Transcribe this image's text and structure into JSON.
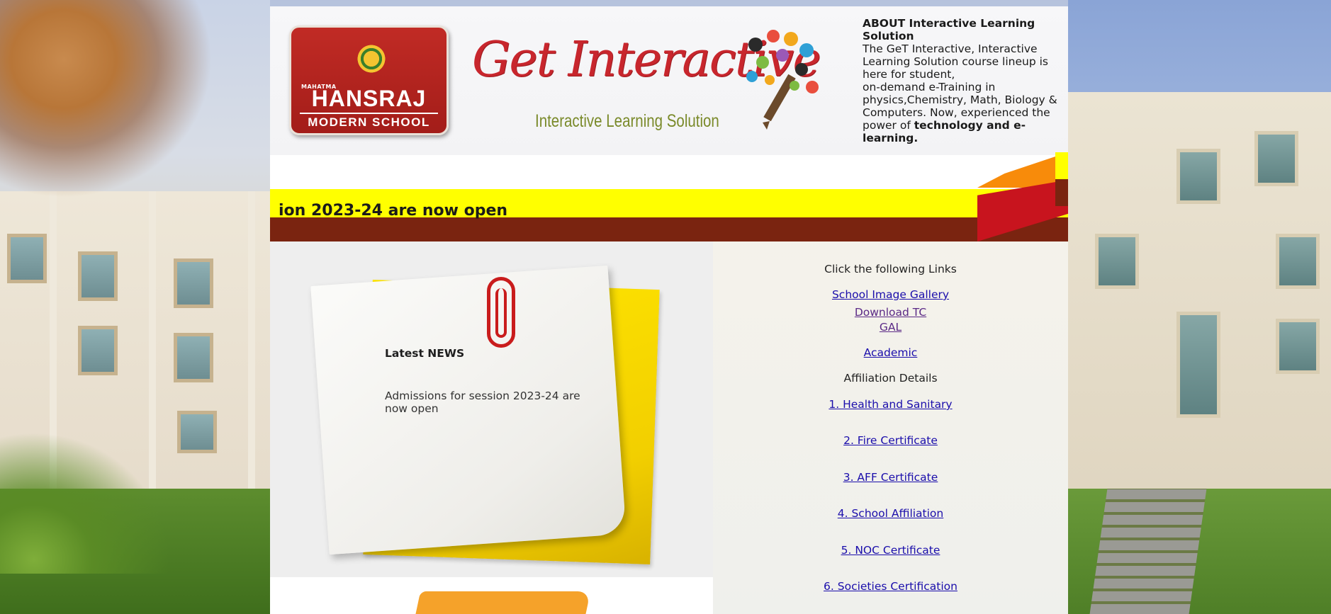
{
  "school_logo": {
    "top_line": "MAHATMA",
    "name": "HANSRAJ",
    "subtitle": "MODERN SCHOOL"
  },
  "brand": {
    "title": "Get Interactive",
    "tagline": "Interactive Learning Solution"
  },
  "about": {
    "heading": "ABOUT Interactive Learning Solution",
    "line1": "The GeT Interactive, Interactive Learning Solution course lineup is here for student,",
    "line2": "on-demand e-Training in physics,Chemistry, Math, Biology & Computers. Now, experienced the power of",
    "emphasis": "technology and e-learning."
  },
  "marquee": {
    "text": "ion 2023-24 are now open"
  },
  "news": {
    "title": "Latest NEWS",
    "body": "Admissions for session 2023-24 are now open"
  },
  "links": {
    "intro": "Click the following Links",
    "gallery": "School Image Gallery",
    "download_tc": "Download TC",
    "gal": "GAL",
    "academic": "Academic",
    "affiliation_heading": "Affiliation Details",
    "items": [
      "1. Health and Sanitary",
      "2. Fire Certificate",
      "3. AFF Certificate",
      "4. School Affiliation",
      "5. NOC Certificate",
      "6. Societies Certification"
    ]
  },
  "colors": {
    "ribbon_yellow": "#ffff00",
    "ribbon_brown": "#7a2410",
    "link_blue": "#1a0dab",
    "link_visited": "#5b2a86",
    "brand_red": "#c8262d"
  }
}
